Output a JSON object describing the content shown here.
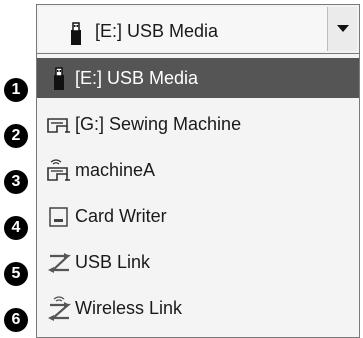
{
  "combo": {
    "selected_label": "[E:] USB Media",
    "selected_icon": "usb-stick-icon",
    "arrow_icon": "chevron-down-icon"
  },
  "dropdown": {
    "items": [
      {
        "label": "[E:] USB Media",
        "icon": "usb-stick-icon",
        "callout": "1",
        "selected": true
      },
      {
        "label": "[G:] Sewing Machine",
        "icon": "sewing-machine-icon",
        "callout": "2",
        "selected": false
      },
      {
        "label": "machineA",
        "icon": "wireless-sewing-machine-icon",
        "callout": "3",
        "selected": false
      },
      {
        "label": "Card Writer",
        "icon": "card-writer-icon",
        "callout": "4",
        "selected": false
      },
      {
        "label": "USB Link",
        "icon": "usb-link-icon",
        "callout": "5",
        "selected": false
      },
      {
        "label": "Wireless Link",
        "icon": "wireless-link-icon",
        "callout": "6",
        "selected": false
      }
    ]
  },
  "colors": {
    "selection_bg": "#555555",
    "selection_text": "#ffffff",
    "list_bg": "#f4f4f4",
    "border": "#7a7a7a"
  }
}
